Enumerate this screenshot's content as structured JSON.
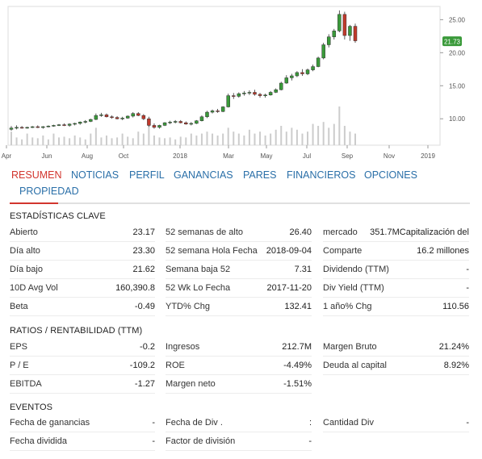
{
  "chart_data": {
    "type": "candlestick",
    "ylim": [
      6,
      27
    ],
    "y_ticks": [
      "25.00",
      "20.00",
      "15.00",
      "10.00"
    ],
    "x_ticks": [
      "Apr",
      "Jun",
      "Aug",
      "Oct",
      "2018",
      "Mar",
      "May",
      "Jul",
      "Sep",
      "Nov",
      "2019"
    ],
    "current_price_label": "21.73",
    "colors": {
      "up": "#3a9a3a",
      "down": "#c0392b",
      "price_tag": "#3a9a3a",
      "volume": "#cccccc"
    },
    "candles": [
      [
        8.4,
        8.9,
        8.2,
        8.6
      ],
      [
        8.6,
        9.0,
        8.4,
        8.7
      ],
      [
        8.7,
        8.9,
        8.5,
        8.6
      ],
      [
        8.6,
        8.8,
        8.5,
        8.7
      ],
      [
        8.7,
        8.9,
        8.6,
        8.8
      ],
      [
        8.8,
        9.0,
        8.6,
        8.7
      ],
      [
        8.7,
        8.9,
        8.5,
        8.8
      ],
      [
        8.8,
        9.0,
        8.7,
        8.9
      ],
      [
        8.9,
        9.1,
        8.8,
        9.0
      ],
      [
        9.0,
        9.2,
        8.9,
        9.1
      ],
      [
        9.1,
        9.3,
        8.9,
        9.0
      ],
      [
        9.0,
        9.3,
        8.8,
        9.2
      ],
      [
        9.2,
        9.4,
        9.0,
        9.3
      ],
      [
        9.3,
        9.6,
        9.1,
        9.5
      ],
      [
        9.5,
        9.8,
        9.3,
        9.6
      ],
      [
        9.6,
        10.0,
        9.5,
        9.9
      ],
      [
        9.9,
        10.8,
        9.8,
        10.5
      ],
      [
        10.5,
        10.9,
        10.3,
        10.6
      ],
      [
        10.6,
        10.8,
        10.2,
        10.3
      ],
      [
        10.3,
        10.5,
        10.0,
        10.2
      ],
      [
        10.2,
        10.4,
        9.9,
        10.0
      ],
      [
        10.0,
        10.3,
        9.8,
        10.1
      ],
      [
        10.1,
        10.5,
        10.0,
        10.4
      ],
      [
        10.4,
        11.0,
        10.2,
        10.8
      ],
      [
        10.8,
        11.0,
        10.4,
        10.5
      ],
      [
        10.5,
        10.7,
        9.8,
        10.0
      ],
      [
        10.0,
        10.3,
        8.8,
        9.0
      ],
      [
        9.0,
        9.3,
        8.5,
        8.7
      ],
      [
        8.7,
        9.1,
        8.5,
        9.0
      ],
      [
        9.0,
        9.5,
        8.9,
        9.4
      ],
      [
        9.4,
        9.7,
        9.2,
        9.5
      ],
      [
        9.5,
        9.8,
        9.3,
        9.6
      ],
      [
        9.6,
        9.8,
        9.3,
        9.4
      ],
      [
        9.4,
        9.6,
        9.1,
        9.2
      ],
      [
        9.2,
        9.5,
        9.0,
        9.3
      ],
      [
        9.3,
        9.8,
        9.2,
        9.7
      ],
      [
        9.7,
        10.5,
        9.6,
        10.3
      ],
      [
        10.3,
        11.2,
        10.1,
        11.0
      ],
      [
        11.0,
        11.4,
        10.8,
        11.2
      ],
      [
        11.2,
        11.5,
        10.9,
        11.1
      ],
      [
        11.1,
        11.9,
        11.0,
        11.8
      ],
      [
        11.8,
        13.8,
        11.7,
        13.5
      ],
      [
        13.5,
        13.9,
        13.0,
        13.4
      ],
      [
        13.4,
        14.0,
        13.2,
        13.8
      ],
      [
        13.8,
        14.2,
        13.5,
        13.9
      ],
      [
        13.9,
        14.3,
        13.6,
        14.0
      ],
      [
        14.0,
        14.4,
        13.5,
        13.7
      ],
      [
        13.7,
        13.9,
        13.2,
        13.5
      ],
      [
        13.5,
        13.8,
        13.2,
        13.6
      ],
      [
        13.6,
        14.2,
        13.5,
        14.0
      ],
      [
        14.0,
        14.6,
        13.9,
        14.4
      ],
      [
        14.4,
        15.6,
        14.3,
        15.4
      ],
      [
        15.4,
        16.6,
        15.3,
        16.2
      ],
      [
        16.2,
        16.8,
        15.8,
        16.5
      ],
      [
        16.5,
        17.2,
        16.3,
        17.0
      ],
      [
        17.0,
        17.5,
        16.5,
        16.8
      ],
      [
        16.8,
        17.6,
        16.6,
        17.4
      ],
      [
        17.4,
        18.2,
        17.2,
        17.9
      ],
      [
        17.9,
        19.4,
        17.8,
        19.2
      ],
      [
        19.2,
        21.5,
        19.0,
        21.2
      ],
      [
        21.2,
        22.8,
        20.8,
        22.4
      ],
      [
        22.4,
        23.6,
        22.0,
        23.3
      ],
      [
        23.3,
        26.4,
        23.1,
        25.8
      ],
      [
        25.8,
        26.2,
        22.0,
        22.6
      ],
      [
        22.6,
        24.2,
        21.8,
        24.0
      ],
      [
        24.0,
        24.4,
        21.5,
        21.8
      ]
    ],
    "volumes": [
      0.35,
      0.2,
      0.15,
      0.3,
      0.2,
      0.18,
      0.25,
      0.15,
      0.3,
      0.2,
      0.22,
      0.18,
      0.25,
      0.2,
      0.15,
      0.3,
      0.45,
      0.2,
      0.25,
      0.18,
      0.2,
      0.3,
      0.22,
      0.18,
      0.35,
      0.3,
      0.55,
      0.25,
      0.2,
      0.18,
      0.2,
      0.15,
      0.22,
      0.2,
      0.3,
      0.25,
      0.3,
      0.35,
      0.3,
      0.25,
      0.3,
      0.45,
      0.35,
      0.3,
      0.25,
      0.4,
      0.3,
      0.35,
      0.25,
      0.3,
      0.4,
      0.5,
      0.35,
      0.45,
      0.4,
      0.3,
      0.35,
      0.55,
      0.5,
      0.6,
      0.45,
      0.55,
      1.0,
      0.5,
      0.35,
      0.3
    ]
  },
  "tabs": [
    "RESUMEN",
    "NOTICIAS",
    "PERFIL",
    "GANANCIAS",
    "PARES",
    "FINANCIEROS",
    "OPCIONES",
    "PROPIEDAD"
  ],
  "sections": {
    "key_stats": {
      "title": "ESTADÍSTICAS CLAVE",
      "col1": [
        {
          "label": "Abierto",
          "value": "23.17"
        },
        {
          "label": "Día alto",
          "value": "23.30"
        },
        {
          "label": "Día bajo",
          "value": "21.62"
        },
        {
          "label": "10D Avg Vol",
          "value": "160,390.8"
        },
        {
          "label": "Beta",
          "value": "-0.49"
        }
      ],
      "col2": [
        {
          "label": "52 semanas de alto",
          "value": "26.40"
        },
        {
          "label": "52 semana Hola Fecha",
          "value": "2018-09-04"
        },
        {
          "label": "Semana baja 52",
          "value": "7.31"
        },
        {
          "label": "52 Wk Lo Fecha",
          "value": "2017-11-20"
        },
        {
          "label": "YTD% Chg",
          "value": "132.41"
        }
      ],
      "col3": [
        {
          "label": "mercado",
          "value": "351.7MCapitalización del"
        },
        {
          "label": "Comparte",
          "value": "16.2 millones"
        },
        {
          "label": "Dividendo (TTM)",
          "value": "-"
        },
        {
          "label": "Div Yield (TTM)",
          "value": "-"
        },
        {
          "label": "1 año% Chg",
          "value": "110.56"
        }
      ]
    },
    "ratios": {
      "title": "RATIOS / RENTABILIDAD (TTM)",
      "col1": [
        {
          "label": "EPS",
          "value": "-0.2"
        },
        {
          "label": "P / E",
          "value": "-109.2"
        },
        {
          "label": "EBITDA",
          "value": "-1.27"
        }
      ],
      "col2": [
        {
          "label": "Ingresos",
          "value": "212.7M"
        },
        {
          "label": "ROE",
          "value": "-4.49%"
        },
        {
          "label": "Margen neto",
          "value": "-1.51%"
        }
      ],
      "col3": [
        {
          "label": "Margen Bruto",
          "value": "21.24%"
        },
        {
          "label": "Deuda al capital",
          "value": "8.92%"
        }
      ]
    },
    "events": {
      "title": "EVENTOS",
      "col1": [
        {
          "label": "Fecha de ganancias",
          "value": "-"
        },
        {
          "label": "Fecha dividida",
          "value": "-"
        }
      ],
      "col2": [
        {
          "label": "Fecha de Div .",
          "value": ":"
        },
        {
          "label": "Factor de división",
          "value": "-"
        }
      ],
      "col3": [
        {
          "label": "Cantidad Div",
          "value": "-"
        }
      ]
    }
  }
}
